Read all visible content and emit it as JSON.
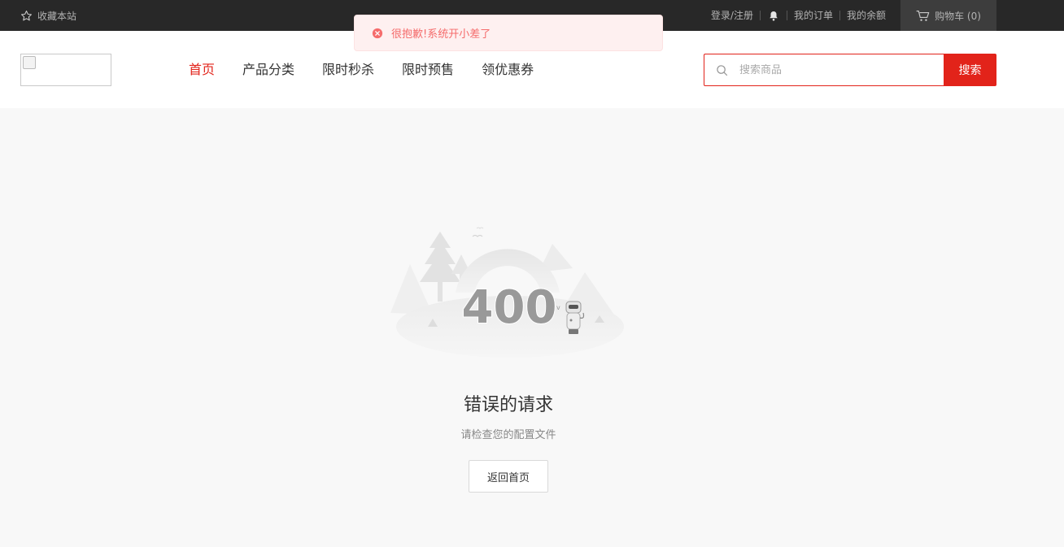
{
  "topbar": {
    "favorite_label": "收藏本站",
    "login_label": "登录/注册",
    "orders_label": "我的订单",
    "balance_label": "我的余额",
    "cart_label": "购物车 (0)"
  },
  "header": {
    "nav": [
      {
        "label": "首页",
        "active": true
      },
      {
        "label": "产品分类"
      },
      {
        "label": "限时秒杀"
      },
      {
        "label": "限时预售"
      },
      {
        "label": "领优惠券"
      }
    ],
    "search": {
      "placeholder": "搜索商品",
      "button_label": "搜索"
    }
  },
  "toast": {
    "message": "很抱歉!系统开小差了",
    "type": "error"
  },
  "error": {
    "code": "400",
    "title": "错误的请求",
    "subtitle": "请检查您的配置文件",
    "button_label": "返回首页"
  },
  "colors": {
    "accent": "#e2231a",
    "topbar": "#282828",
    "error_toast": "#f56c6c"
  }
}
